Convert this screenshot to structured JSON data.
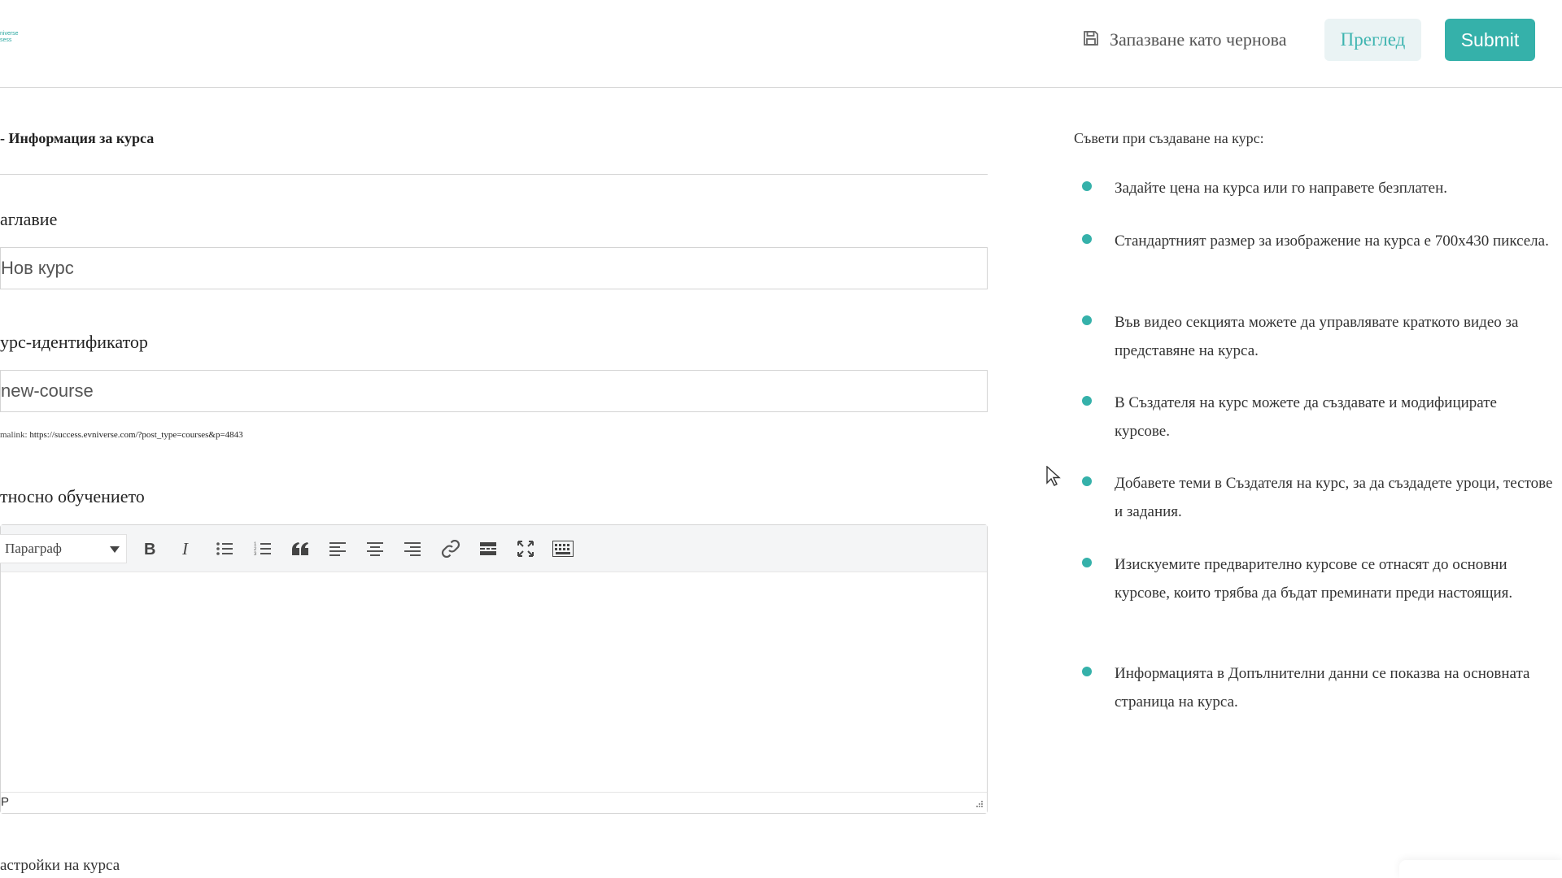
{
  "header": {
    "logo_text": "niverse\nsess",
    "save_draft_label": "Запазване като чернова",
    "preview_label": "Преглед",
    "submit_label": "Submit"
  },
  "form": {
    "section_title": "- Информация за курса",
    "title_label": "аглавие",
    "title_value": "Нов курс",
    "slug_label": "урс-идентификатор",
    "slug_value": "new-course",
    "permalink_label": "malink:",
    "permalink_url": "https://success.evniverse.com/?post_type=courses&p=4843",
    "about_label": "тносно обучението",
    "editor": {
      "format_value": "Параграф",
      "status_path": "P"
    },
    "next_section_label": "астройки на курса"
  },
  "tips": {
    "title": "Съвети при създаване на курс:",
    "items": [
      "Задайте цена на курса или го направете безплатен.",
      "Стандартният размер за изображение на курса е 700x430 пиксела.",
      "Във видео секцията можете да управлявате краткото видео за представяне на курса.",
      "В Създателя на курс можете да създавате и модифицирате курсове.",
      "Добавете теми в Създателя на курс, за да създадете уроци, тестове и задания.",
      "Изискуемите предварително курсове се отнасят до основни курсове, които трябва да бъдат преминати преди настоящия.",
      "Информацията в Допълнителни данни се показва на основната страница на курса."
    ]
  },
  "colors": {
    "accent": "#35b1aa",
    "preview_bg": "#eaf3f4",
    "toolbar_bg": "#f4f5f6"
  }
}
